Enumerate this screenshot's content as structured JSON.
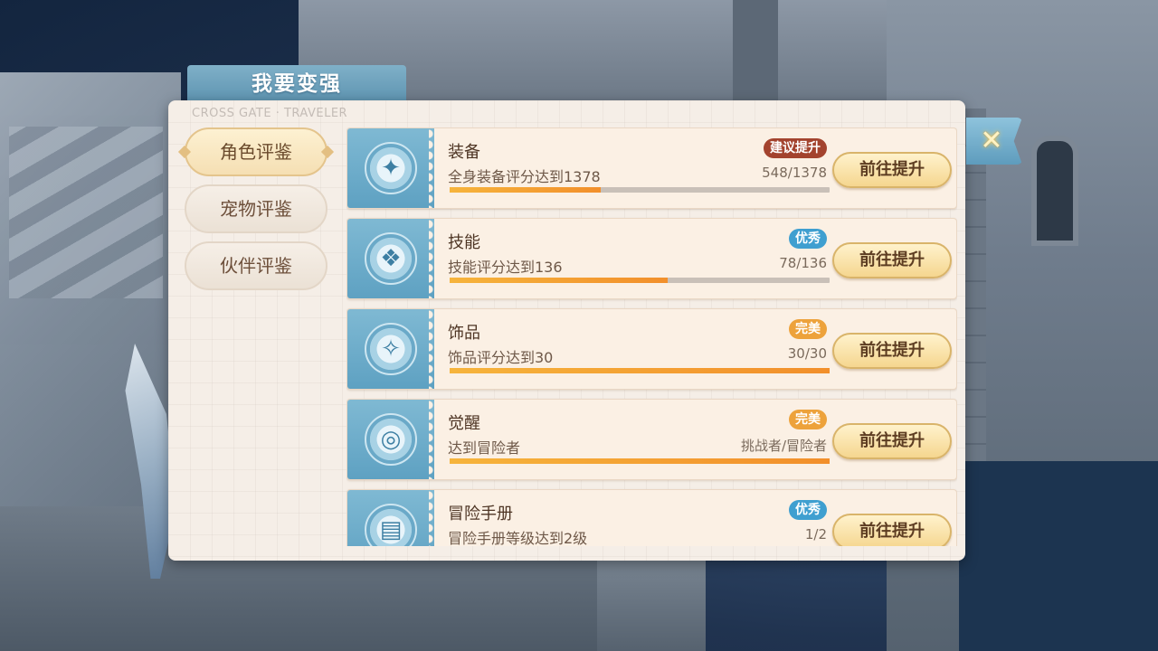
{
  "dialog": {
    "title": "我要变强",
    "subtitle": "CROSS GATE · TRAVELER"
  },
  "side_tabs": [
    {
      "label": "角色评鉴",
      "active": true
    },
    {
      "label": "宠物评鉴",
      "active": false
    },
    {
      "label": "伙伴评鉴",
      "active": false
    }
  ],
  "rows": [
    {
      "name": "装备",
      "desc": "全身装备评分达到1378",
      "badge": "建议提升",
      "badge_color": "#a3432e",
      "progress_text": "548/1378",
      "progress": 0.398,
      "button": "前往提升",
      "icon": "equipment-icon",
      "glyph": "✦"
    },
    {
      "name": "技能",
      "desc": "技能评分达到136",
      "badge": "优秀",
      "badge_color": "#3f9fd0",
      "progress_text": "78/136",
      "progress": 0.574,
      "button": "前往提升",
      "icon": "skill-book-icon",
      "glyph": "❖"
    },
    {
      "name": "饰品",
      "desc": "饰品评分达到30",
      "badge": "完美",
      "badge_color": "#eda23b",
      "progress_text": "30/30",
      "progress": 1.0,
      "button": "前往提升",
      "icon": "accessory-icon",
      "glyph": "✧"
    },
    {
      "name": "觉醒",
      "desc": "达到冒险者",
      "badge": "完美",
      "badge_color": "#eda23b",
      "progress_text": "挑战者/冒险者",
      "progress": 1.0,
      "button": "前往提升",
      "icon": "awaken-icon",
      "glyph": "◎"
    },
    {
      "name": "冒险手册",
      "desc": "冒险手册等级达到2级",
      "badge": "优秀",
      "badge_color": "#3f9fd0",
      "progress_text": "1/2",
      "progress": 0.5,
      "button": "前往提升",
      "icon": "handbook-icon",
      "glyph": "▤"
    }
  ],
  "close_icon": "close-icon"
}
